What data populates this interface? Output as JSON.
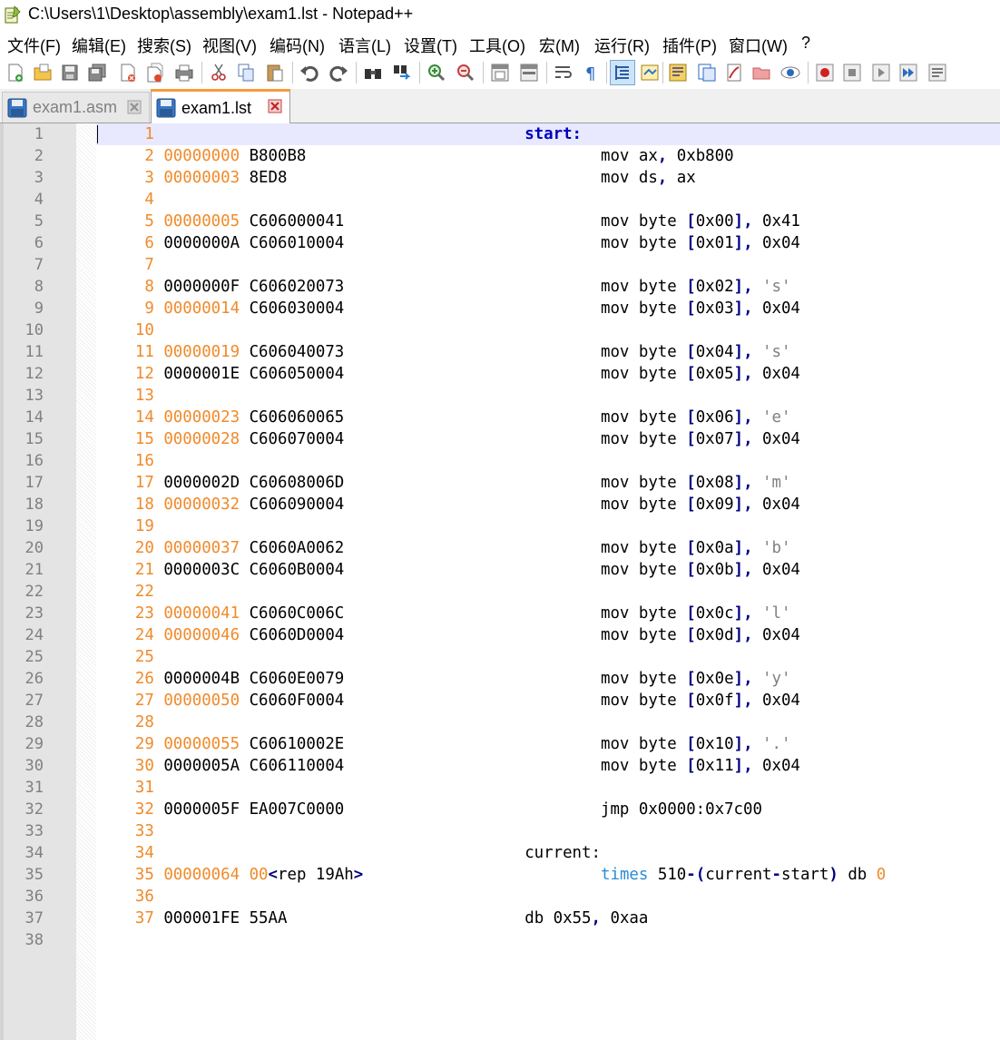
{
  "window": {
    "title": "C:\\Users\\1\\Desktop\\assembly\\exam1.lst - Notepad++"
  },
  "menu": [
    "文件(F)",
    "编辑(E)",
    "搜索(S)",
    "视图(V)",
    "编码(N)",
    "语言(L)",
    "设置(T)",
    "工具(O)",
    "宏(M)",
    "运行(R)",
    "插件(P)",
    "窗口(W)",
    "?"
  ],
  "toolbar": {
    "icons": [
      "new-file-icon",
      "open-file-icon",
      "save-icon",
      "save-all-icon",
      "close-icon",
      "close-all-icon",
      "print-icon",
      "cut-icon",
      "copy-icon",
      "paste-icon",
      "undo-icon",
      "redo-icon",
      "find-icon",
      "replace-icon",
      "zoom-in-icon",
      "zoom-out-icon",
      "sync-v-icon",
      "sync-h-icon",
      "word-wrap-icon",
      "show-all-chars-icon",
      "indent-guide-icon",
      "udl-icon",
      "doc-map-icon",
      "func-list-icon",
      "folder-workspace-icon",
      "doc-switcher-icon",
      "monitor-icon",
      "record-macro-icon",
      "stop-record-icon",
      "play-macro-icon",
      "run-macro-multiple-icon",
      "save-macro-icon"
    ]
  },
  "tabs": [
    {
      "label": "exam1.asm",
      "active": false
    },
    {
      "label": "exam1.lst",
      "active": true
    }
  ],
  "editor": {
    "current_line": 1,
    "lines": [
      {
        "n": "1",
        "lno": "1",
        "addr": "",
        "addr_color": "",
        "hex": "",
        "label": "start:",
        "code": ""
      },
      {
        "n": "2",
        "lno": "2",
        "addr": "00000000",
        "addr_color": "o",
        "hex": "B800B8",
        "label": "",
        "code": "mov ax, 0xb800"
      },
      {
        "n": "3",
        "lno": "3",
        "addr": "00000003",
        "addr_color": "o",
        "hex": "8ED8",
        "label": "",
        "code": "mov ds, ax"
      },
      {
        "n": "4",
        "lno": "4",
        "addr": "",
        "addr_color": "",
        "hex": "",
        "label": "",
        "code": ""
      },
      {
        "n": "5",
        "lno": "5",
        "addr": "00000005",
        "addr_color": "o",
        "hex": "C606000041",
        "label": "",
        "code": "mov byte [0x00], 0x41"
      },
      {
        "n": "6",
        "lno": "6",
        "addr": "0000000A",
        "addr_color": "b",
        "hex": "C606010004",
        "label": "",
        "code": "mov byte [0x01], 0x04"
      },
      {
        "n": "7",
        "lno": "7",
        "addr": "",
        "addr_color": "",
        "hex": "",
        "label": "",
        "code": ""
      },
      {
        "n": "8",
        "lno": "8",
        "addr": "0000000F",
        "addr_color": "b",
        "hex": "C606020073",
        "label": "",
        "code": "mov byte [0x02], 's'"
      },
      {
        "n": "9",
        "lno": "9",
        "addr": "00000014",
        "addr_color": "o",
        "hex": "C606030004",
        "label": "",
        "code": "mov byte [0x03], 0x04"
      },
      {
        "n": "10",
        "lno": "10",
        "addr": "",
        "addr_color": "",
        "hex": "",
        "label": "",
        "code": ""
      },
      {
        "n": "11",
        "lno": "11",
        "addr": "00000019",
        "addr_color": "o",
        "hex": "C606040073",
        "label": "",
        "code": "mov byte [0x04], 's'"
      },
      {
        "n": "12",
        "lno": "12",
        "addr": "0000001E",
        "addr_color": "b",
        "hex": "C606050004",
        "label": "",
        "code": "mov byte [0x05], 0x04"
      },
      {
        "n": "13",
        "lno": "13",
        "addr": "",
        "addr_color": "",
        "hex": "",
        "label": "",
        "code": ""
      },
      {
        "n": "14",
        "lno": "14",
        "addr": "00000023",
        "addr_color": "o",
        "hex": "C606060065",
        "label": "",
        "code": "mov byte [0x06], 'e'"
      },
      {
        "n": "15",
        "lno": "15",
        "addr": "00000028",
        "addr_color": "o",
        "hex": "C606070004",
        "label": "",
        "code": "mov byte [0x07], 0x04"
      },
      {
        "n": "16",
        "lno": "16",
        "addr": "",
        "addr_color": "",
        "hex": "",
        "label": "",
        "code": ""
      },
      {
        "n": "17",
        "lno": "17",
        "addr": "0000002D",
        "addr_color": "b",
        "hex": "C60608006D",
        "label": "",
        "code": "mov byte [0x08], 'm'"
      },
      {
        "n": "18",
        "lno": "18",
        "addr": "00000032",
        "addr_color": "o",
        "hex": "C606090004",
        "label": "",
        "code": "mov byte [0x09], 0x04"
      },
      {
        "n": "19",
        "lno": "19",
        "addr": "",
        "addr_color": "",
        "hex": "",
        "label": "",
        "code": ""
      },
      {
        "n": "20",
        "lno": "20",
        "addr": "00000037",
        "addr_color": "o",
        "hex": "C6060A0062",
        "label": "",
        "code": "mov byte [0x0a], 'b'"
      },
      {
        "n": "21",
        "lno": "21",
        "addr": "0000003C",
        "addr_color": "b",
        "hex": "C6060B0004",
        "label": "",
        "code": "mov byte [0x0b], 0x04"
      },
      {
        "n": "22",
        "lno": "22",
        "addr": "",
        "addr_color": "",
        "hex": "",
        "label": "",
        "code": ""
      },
      {
        "n": "23",
        "lno": "23",
        "addr": "00000041",
        "addr_color": "o",
        "hex": "C6060C006C",
        "label": "",
        "code": "mov byte [0x0c], 'l'"
      },
      {
        "n": "24",
        "lno": "24",
        "addr": "00000046",
        "addr_color": "o",
        "hex": "C6060D0004",
        "label": "",
        "code": "mov byte [0x0d], 0x04"
      },
      {
        "n": "25",
        "lno": "25",
        "addr": "",
        "addr_color": "",
        "hex": "",
        "label": "",
        "code": ""
      },
      {
        "n": "26",
        "lno": "26",
        "addr": "0000004B",
        "addr_color": "b",
        "hex": "C6060E0079",
        "label": "",
        "code": "mov byte [0x0e], 'y'"
      },
      {
        "n": "27",
        "lno": "27",
        "addr": "00000050",
        "addr_color": "o",
        "hex": "C6060F0004",
        "label": "",
        "code": "mov byte [0x0f], 0x04"
      },
      {
        "n": "28",
        "lno": "28",
        "addr": "",
        "addr_color": "",
        "hex": "",
        "label": "",
        "code": ""
      },
      {
        "n": "29",
        "lno": "29",
        "addr": "00000055",
        "addr_color": "o",
        "hex": "C60610002E",
        "label": "",
        "code": "mov byte [0x10], '.'"
      },
      {
        "n": "30",
        "lno": "30",
        "addr": "0000005A",
        "addr_color": "b",
        "hex": "C606110004",
        "label": "",
        "code": "mov byte [0x11], 0x04"
      },
      {
        "n": "31",
        "lno": "31",
        "addr": "",
        "addr_color": "",
        "hex": "",
        "label": "",
        "code": ""
      },
      {
        "n": "32",
        "lno": "32",
        "addr": "0000005F",
        "addr_color": "b",
        "hex": "EA007C0000",
        "label": "",
        "code": "jmp 0x0000:0x7c00"
      },
      {
        "n": "33",
        "lno": "33",
        "addr": "",
        "addr_color": "",
        "hex": "",
        "label": "",
        "code": ""
      },
      {
        "n": "34",
        "lno": "34",
        "addr": "",
        "addr_color": "",
        "hex": "",
        "label": "current:",
        "code": ""
      },
      {
        "n": "35",
        "lno": "35",
        "addr": "00000064",
        "addr_color": "o",
        "hex": "00",
        "hex_suffix": "<rep 19Ah>",
        "label": "",
        "code": "times 510-(current-start) db 0"
      },
      {
        "n": "36",
        "lno": "36",
        "addr": "",
        "addr_color": "",
        "hex": "",
        "label": "",
        "code": ""
      },
      {
        "n": "37",
        "lno": "37",
        "addr": "000001FE",
        "addr_color": "b",
        "hex": "55AA",
        "label": "db 0x55, 0xaa",
        "code": ""
      },
      {
        "n": "38",
        "lno": "",
        "addr": "",
        "addr_color": "",
        "hex": "",
        "label": "",
        "code": ""
      }
    ]
  },
  "colors": {
    "orange": "#f08a2a",
    "operator": "#000080",
    "keyword": "#2a8cd6",
    "current_line": "#e8e8ff"
  }
}
